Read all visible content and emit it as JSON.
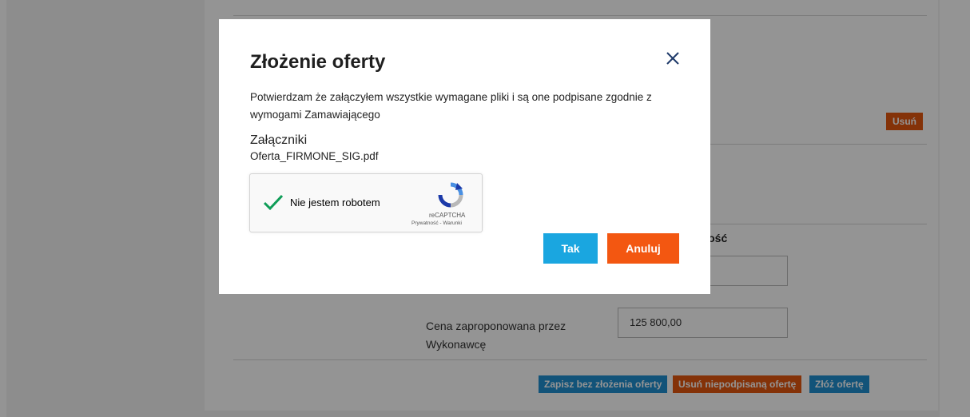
{
  "page": {
    "remove_label": "Usuń",
    "value_header_partial": "rtość",
    "price_label": "Cena zaproponowana przez Wykonawcę",
    "price_value": "125 800,00",
    "save_without_offer_label": "Zapisz bez złożenia oferty",
    "remove_unsigned_label": "Usuń niepodpisaną ofertę",
    "submit_offer_label": "Złóż ofertę"
  },
  "modal": {
    "title": "Złożenie oferty",
    "confirmation_text": "Potwierdzam że załączyłem wszystkie wymagane pliki i są one podpisane zgodnie z wymogami Zamawiającego",
    "attachments_title": "Załączniki",
    "attachment_file": "Oferta_FIRMONE_SIG.pdf",
    "captcha": {
      "label": "Nie jestem robotem",
      "brand": "reCAPTCHA",
      "links": "Prywatność - Warunki",
      "checked": true
    },
    "yes_label": "Tak",
    "cancel_label": "Anuluj"
  },
  "colors": {
    "primary_blue": "#1aa6e0",
    "accent_orange": "#f35711",
    "captcha_check": "#0f9d58"
  },
  "icons": {
    "close": "close-icon",
    "check": "checkmark-icon",
    "recaptcha": "recaptcha-logo-icon"
  }
}
